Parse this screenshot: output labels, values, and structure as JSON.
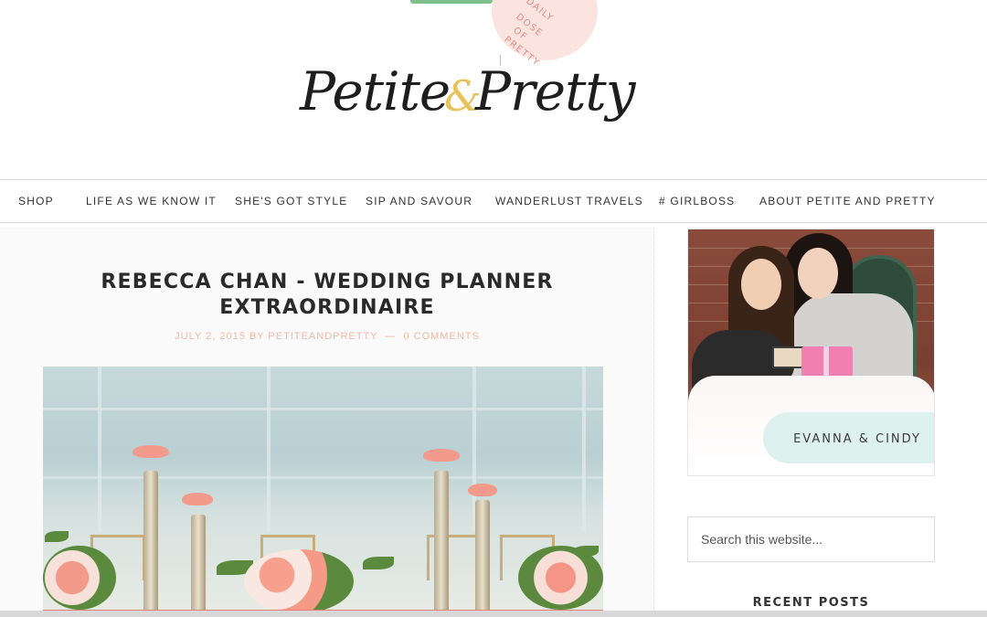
{
  "header": {
    "badge_lines": [
      "DAILY",
      "DOSE",
      "OF",
      "PRETTY"
    ],
    "logo": {
      "word1": "Petite",
      "ampersand": "&",
      "word2": "Pretty"
    }
  },
  "nav": {
    "items": [
      {
        "label": "SHOP"
      },
      {
        "label": "LIFE AS WE KNOW IT"
      },
      {
        "label": "SHE'S GOT STYLE"
      },
      {
        "label": "SIP AND SAVOUR"
      },
      {
        "label": "WANDERLUST TRAVELS"
      },
      {
        "label": "# GIRLBOSS"
      },
      {
        "label": "ABOUT PETITE AND PRETTY"
      }
    ]
  },
  "post": {
    "title_line1": "REBECCA CHAN - WEDDING PLANNER",
    "title_line2": "EXTRAORDINAIRE",
    "date": "JULY 2, 2015",
    "by": "BY",
    "author": "PETITEANDPRETTY",
    "separator": "—",
    "comments": "0 COMMENTS",
    "image_subject": "wedding-table-centerpiece"
  },
  "sidebar": {
    "photo_caption": "EVANNA & CINDY",
    "search_placeholder": "Search this website...",
    "recent_heading": "RECENT POSTS"
  },
  "colors": {
    "accent_gold": "#e8c25a",
    "meta_peach": "#f0b9a4",
    "nav_border": "#d8dde0",
    "mint": "#d9f0ec"
  }
}
